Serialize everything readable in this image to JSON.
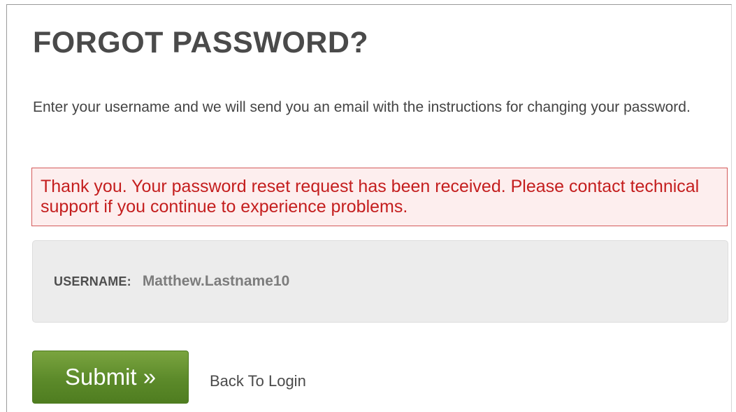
{
  "page": {
    "title": "FORGOT PASSWORD?",
    "instructions": "Enter your username and we will send you an email with the instructions for changing your password."
  },
  "alert": {
    "message": "Thank you. Your password reset request has been received. Please contact technical support if you continue to experience problems."
  },
  "form": {
    "username_label": "USERNAME:",
    "username_value": "Matthew.Lastname10"
  },
  "actions": {
    "submit_label": "Submit »",
    "back_label": "Back To Login"
  },
  "colors": {
    "alert_text": "#c41e1e",
    "alert_background": "#fdeeee",
    "submit_background": "#5c8a2a"
  }
}
